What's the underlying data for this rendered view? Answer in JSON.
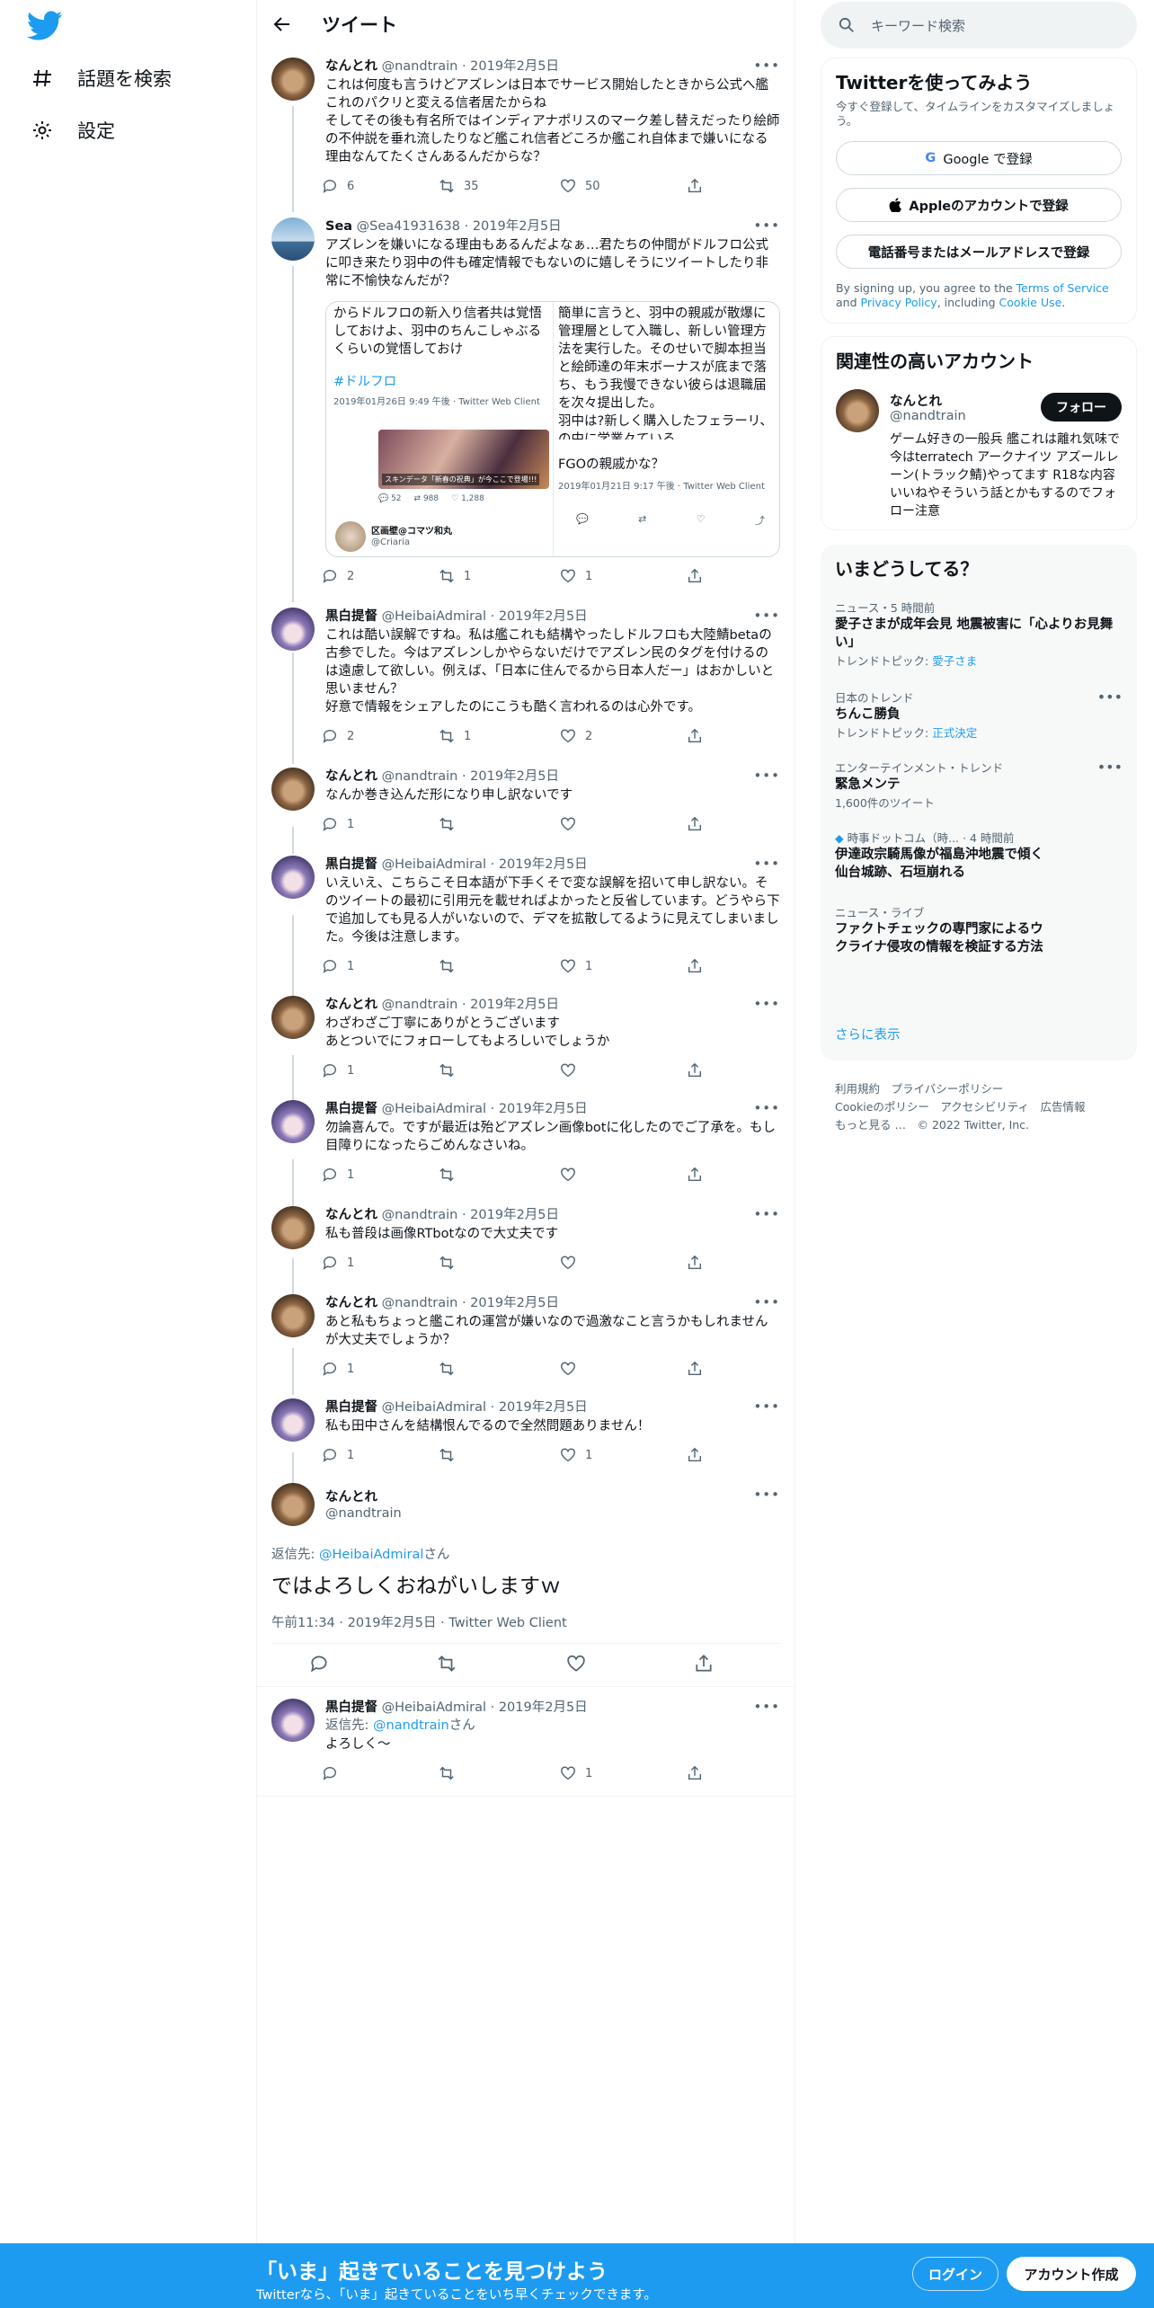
{
  "nav": {
    "explore_label": "話題を検索",
    "settings_label": "設定"
  },
  "header": {
    "title": "ツイート"
  },
  "tweets": [
    {
      "name": "なんとれ",
      "handle": "@nandtrain",
      "date": "2019年2月5日",
      "text": "これは何度も言うけどアズレンは日本でサービス開始したときから公式へ艦これのパクリと変える信者居たからね\nそしてその後も有名所ではインディアナポリスのマーク差し替えだったり絵師の不仲説を垂れ流したりなど艦これ信者どころか艦これ自体まで嫌いになる理由なんてたくさんあるんだからな？",
      "replies": "6",
      "retweets": "35",
      "likes": "50"
    },
    {
      "name": "Sea",
      "handle": "@Sea41931638",
      "date": "2019年2月5日",
      "text": "アズレンを嫌いになる理由もあるんだよなぁ…君たちの仲間がドルフロ公式に叩き来たり羽中の件も確定情報でもないのに嬉しそうにツイートしたり非常に不愉快なんだが？",
      "replies": "2",
      "retweets": "1",
      "likes": "1"
    },
    {
      "name": "黒白提督",
      "handle": "@HeibaiAdmiral",
      "date": "2019年2月5日",
      "text": "これは酷い誤解ですね。私は艦これも結構やったしドルフロも大陸鯖betaの古参でした。今はアズレンしかやらないだけでアズレン民のタグを付けるのは遠慮して欲しい。例えば、「日本に住んでるから日本人だー」はおかしいと思いません？\n好意で情報をシェアしたのにこうも酷く言われるのは心外です。",
      "replies": "2",
      "retweets": "1",
      "likes": "2"
    },
    {
      "name": "なんとれ",
      "handle": "@nandtrain",
      "date": "2019年2月5日",
      "text": "なんか巻き込んだ形になり申し訳ないです",
      "replies": "1",
      "retweets": "",
      "likes": ""
    },
    {
      "name": "黒白提督",
      "handle": "@HeibaiAdmiral",
      "date": "2019年2月5日",
      "text": "いえいえ、こちらこそ日本語が下手くそで変な誤解を招いて申し訳ない。そのツイートの最初に引用元を載せればよかったと反省しています。どうやら下で追加しても見る人がいないので、デマを拡散してるように見えてしまいました。今後は注意します。",
      "replies": "1",
      "retweets": "",
      "likes": "1"
    },
    {
      "name": "なんとれ",
      "handle": "@nandtrain",
      "date": "2019年2月5日",
      "text": "わざわざご丁寧にありがとうございます\nあとついでにフォローしてもよろしいでしょうか",
      "replies": "1",
      "retweets": "",
      "likes": ""
    },
    {
      "name": "黒白提督",
      "handle": "@HeibaiAdmiral",
      "date": "2019年2月5日",
      "text": "勿論喜んで。ですが最近は殆どアズレン画像botに化したのでご了承を。もし目障りになったらごめんなさいね。",
      "replies": "1",
      "retweets": "",
      "likes": ""
    },
    {
      "name": "なんとれ",
      "handle": "@nandtrain",
      "date": "2019年2月5日",
      "text": "私も普段は画像RTbotなので大丈夫です",
      "replies": "1",
      "retweets": "",
      "likes": ""
    },
    {
      "name": "なんとれ",
      "handle": "@nandtrain",
      "date": "2019年2月5日",
      "text": "あと私もちょっと艦これの運営が嫌いなので過激なこと言うかもしれませんが大丈夫でしょうか？",
      "replies": "1",
      "retweets": "",
      "likes": ""
    },
    {
      "name": "黒白提督",
      "handle": "@HeibaiAdmiral",
      "date": "2019年2月5日",
      "text": "私も田中さんを結構恨んでるので全然問題ありません！",
      "replies": "1",
      "retweets": "",
      "likes": "1"
    }
  ],
  "embed": {
    "left_text": "からドルフロの新入り信者共は覚悟しておけよ、羽中のちんこしゃぶるくらいの覚悟しておけ",
    "left_tag": "#ドルフロ",
    "left_meta": "2019年01月26日 9:49 午後 · Twitter Web Client",
    "left_user_name": "区画壁@コマツ和丸",
    "left_user_handle": "@Criaria",
    "left_counts": {
      "replies": "52",
      "retweets": "988",
      "likes": "1,288"
    },
    "img_caption": "スキンデータ「新春の祝典」が今ここで登場!!!",
    "right_text": "簡単に言うと、羽中の親戚が散爆に管理層として入職し、新しい管理方法を実行した。そのせいで脚本担当と絵師達の年末ボーナスが底まで落ち、もう我慢できない彼らは退職届を次々提出した。\n羽中は?新しく購入したフェラーリ、の中に学業々ている\n〜〜〜〜",
    "right_title": "FGOの親戚かな？",
    "right_meta": "2019年01月21日 9:17 午後 · Twitter Web Client"
  },
  "main_tweet": {
    "name": "なんとれ",
    "handle": "@nandtrain",
    "reply_prefix": "返信先: ",
    "reply_to": "@HeibaiAdmiral",
    "reply_suffix": "さん",
    "text": "ではよろしくおねがいしますｗ",
    "meta": "午前11:34 · 2019年2月5日 · Twitter Web Client"
  },
  "last_reply": {
    "name": "黒白提督",
    "handle": "@HeibaiAdmiral",
    "date": "2019年2月5日",
    "reply_prefix": "返信先: ",
    "reply_to": "@nandtrain",
    "reply_suffix": "さん",
    "text": "よろしく〜",
    "likes": "1"
  },
  "search": {
    "placeholder": "キーワード検索"
  },
  "signup": {
    "title": "Twitterを使ってみよう",
    "subtitle": "今すぐ登録して、タイムラインをカスタマイズしましょう。",
    "google": "Google で登録",
    "apple": "Appleのアカウントで登録",
    "phone": "電話番号またはメールアドレスで登録",
    "legal_1": "By signing up, you agree to the ",
    "terms": "Terms of Service",
    "legal_2": " and ",
    "privacy": "Privacy Policy",
    "legal_3": ", including ",
    "cookie": "Cookie Use",
    "legal_4": "."
  },
  "relevant": {
    "title": "関連性の高いアカウント",
    "name": "なんとれ",
    "handle": "@nandtrain",
    "follow": "フォロー",
    "bio": "ゲーム好きの一般兵 艦これは離れ気味で今はterratech アークナイツ アズールレーン(トラック鯖)やってます R18な内容いいねやそういう話とかもするのでフォロー注意"
  },
  "trends": {
    "title": "いまどうしてる？",
    "items": [
      {
        "cat": "ニュース・5 時間前",
        "title": "愛子さまが成年会見 地震被害に「心よりお見舞い」",
        "sub_prefix": "トレンドトピック: ",
        "sub_link": "愛子さま"
      },
      {
        "cat": "日本のトレンド",
        "title": "ちんこ勝負",
        "sub_prefix": "トレンドトピック: ",
        "sub_link": "正式決定"
      },
      {
        "cat": "エンターテインメント・トレンド",
        "title": "緊急メンテ",
        "sub_prefix": "1,600件のツイート",
        "sub_link": ""
      },
      {
        "cat": "時事ドットコム（時... · 4 時間前",
        "title": "伊達政宗騎馬像が福島沖地震で傾く　仙台城跡、石垣崩れる",
        "sub_prefix": "",
        "sub_link": ""
      },
      {
        "cat": "ニュース・ライブ",
        "title": "ファクトチェックの専門家によるウクライナ侵攻の情報を検証する方法",
        "sub_prefix": "",
        "sub_link": ""
      }
    ],
    "more": "さらに表示"
  },
  "footer": {
    "line1": "利用規約　プライバシーポリシー",
    "line2": "Cookieのポリシー　アクセシビリティ　広告情報",
    "line3": "もっと見る …　© 2022 Twitter, Inc."
  },
  "bottombar": {
    "title": "「いま」起きていることを見つけよう",
    "subtitle": "Twitterなら、「いま」起きていることをいち早くチェックできます。",
    "login": "ログイン",
    "signup": "アカウント作成"
  },
  "colors": {
    "accent": "#1d9bf0",
    "text": "#0f1419",
    "muted": "#536471"
  }
}
